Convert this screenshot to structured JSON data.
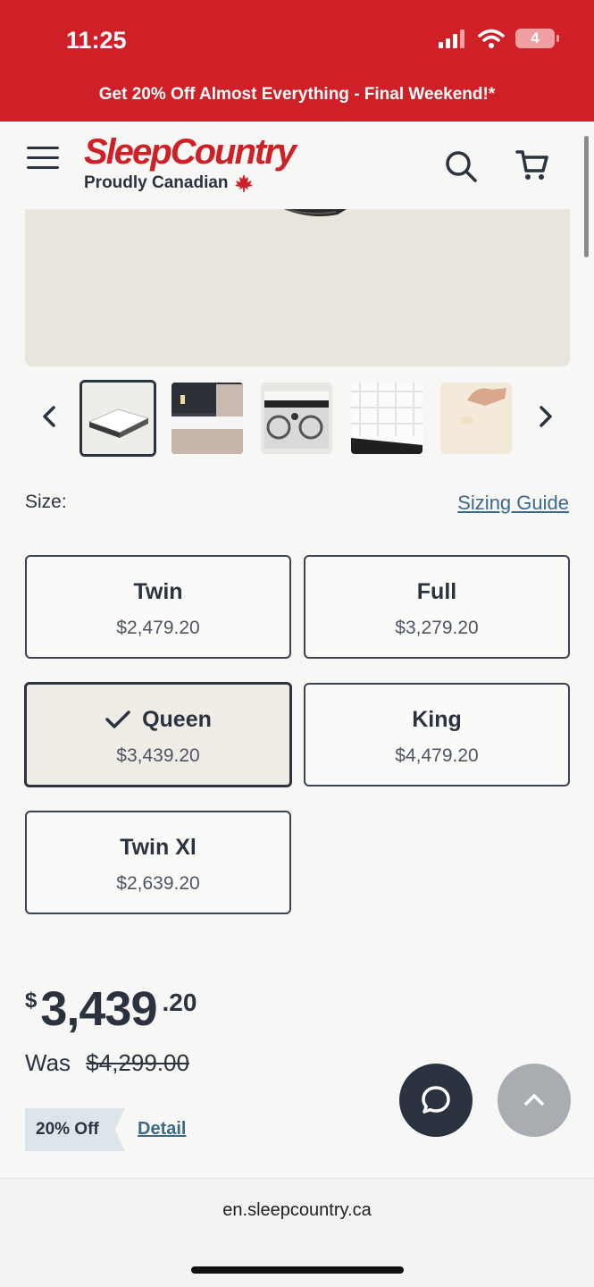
{
  "status": {
    "time": "11:25",
    "battery": "4"
  },
  "promo": {
    "text": "Get 20% Off Almost Everything - Final Weekend!*"
  },
  "header": {
    "logo_name": "SleepCountry",
    "logo_tagline": "Proudly Canadian"
  },
  "carousel": {
    "thumbnails": [
      "mattress-top-view",
      "mattress-in-bedroom",
      "mattress-side-pattern",
      "mattress-quilted-closeup",
      "hand-pressing-foam"
    ],
    "selected_index": 0
  },
  "size_section": {
    "label": "Size:",
    "guide_link": "Sizing Guide",
    "options": [
      {
        "name": "Twin",
        "price": "$2,479.20",
        "selected": false
      },
      {
        "name": "Full",
        "price": "$3,279.20",
        "selected": false
      },
      {
        "name": "Queen",
        "price": "$3,439.20",
        "selected": true
      },
      {
        "name": "King",
        "price": "$4,479.20",
        "selected": false
      },
      {
        "name": "Twin Xl",
        "price": "$2,639.20",
        "selected": false
      }
    ]
  },
  "pricing": {
    "currency": "$",
    "main": "3,439",
    "cents": ".20",
    "was_label": "Was",
    "was_price": "$4,299.00",
    "discount": "20% Off",
    "detail_link": "Detail"
  },
  "browser": {
    "url": "en.sleepcountry.ca"
  },
  "colors": {
    "brand_red": "#d02027",
    "text_dark": "#2c3340",
    "link_blue": "#3a6a88"
  }
}
